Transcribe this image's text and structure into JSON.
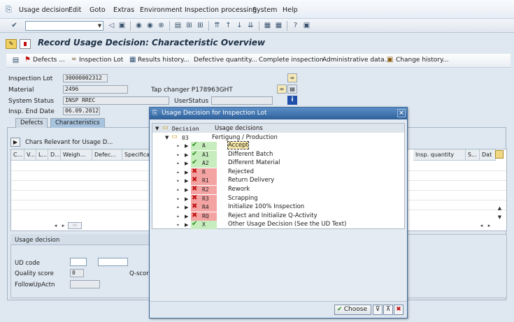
{
  "menu": {
    "icon": "menu-icon",
    "items": [
      "Usage decision",
      "Edit",
      "Goto",
      "Extras",
      "Environment",
      "Inspection processing",
      "System",
      "Help"
    ]
  },
  "page_title": "Record Usage Decision: Characteristic Overview",
  "app_toolbar": {
    "defects": "Defects ...",
    "inspection_lot": "Inspection Lot",
    "results_history": "Results history...",
    "defective_quantity": "Defective quantity...",
    "complete_inspection": "Complete inspection",
    "administrative_data": "Administrative data...",
    "change_history": "Change history..."
  },
  "header": {
    "inspection_lot_label": "Inspection Lot",
    "inspection_lot_value": "30000002312",
    "material_label": "Material",
    "material_value": "2496",
    "material_desc": "Tap changer P178963GHT",
    "system_status_label": "System Status",
    "system_status_value": "INSP RREC",
    "user_status_label": "UserStatus",
    "insp_end_date_label": "Insp. End Date",
    "insp_end_date_value": "06.09.2012"
  },
  "tabs": [
    "Defects",
    "Characteristics"
  ],
  "chars": {
    "header": "Chars Relevant for Usage D...",
    "columns": [
      "C...",
      "V...",
      "L...",
      "D...",
      "Weigh...",
      "Defec...",
      "Specifica"
    ],
    "right_columns": [
      "Insp. quantity",
      "S...",
      "Dat"
    ]
  },
  "usage_decision": {
    "title": "Usage decision",
    "ud_code_label": "UD code",
    "quality_score_label": "Quality score",
    "quality_score_value": "0",
    "followup_label": "FollowUpActn",
    "q_score_label": "Q-score"
  },
  "dialog": {
    "title": "Usage Decision for Inspection Lot",
    "col1": "Decision",
    "col2": "Usage decisions",
    "group_code": "03",
    "group_text": "Fertigung / Production",
    "items": [
      {
        "code": "A",
        "text": "Accept",
        "status": "ok"
      },
      {
        "code": "A1",
        "text": "Different Batch",
        "status": "ok"
      },
      {
        "code": "A2",
        "text": "Different Material",
        "status": "ok"
      },
      {
        "code": "R",
        "text": "Rejected",
        "status": "bad"
      },
      {
        "code": "R1",
        "text": "Return Delivery",
        "status": "bad"
      },
      {
        "code": "R2",
        "text": "Rework",
        "status": "bad"
      },
      {
        "code": "R3",
        "text": "Scrapping",
        "status": "bad"
      },
      {
        "code": "R4",
        "text": "Initialize 100% Inspection",
        "status": "bad"
      },
      {
        "code": "RQ",
        "text": "Reject and Initialize Q-Activity",
        "status": "bad"
      },
      {
        "code": "X",
        "text": "Other Usage Decision (See the UD Text)",
        "status": "ok"
      }
    ],
    "choose_label": "Choose"
  },
  "colors": {
    "accent": "#2e5f99",
    "ok": "#c7ecbd",
    "bad": "#f4a3a3",
    "panel": "#dfe7f0"
  }
}
